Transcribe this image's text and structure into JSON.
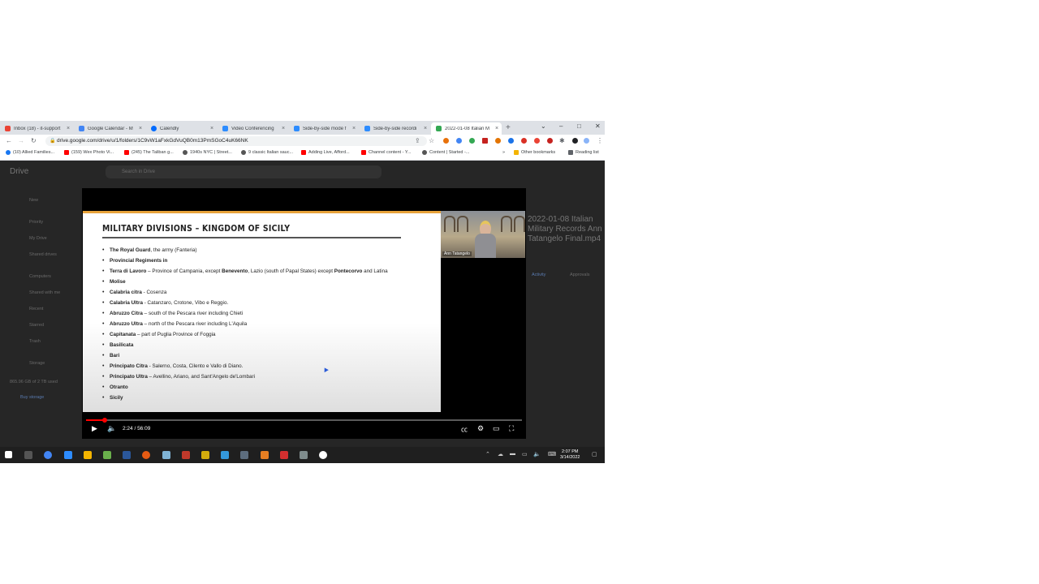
{
  "browser": {
    "tabs": [
      {
        "title": "Inbox (18) - it-support",
        "color": "#ea4335"
      },
      {
        "title": "Google Calendar - M",
        "color": "#4285f4"
      },
      {
        "title": "Calendly",
        "color": "#006bff"
      },
      {
        "title": "Video Conferencing",
        "color": "#2d8cff"
      },
      {
        "title": "Side-by-side mode f",
        "color": "#2d8cff"
      },
      {
        "title": "Side-by-side recordi",
        "color": "#2d8cff"
      },
      {
        "title": "2022-01-08 Italian M",
        "color": "#34a853"
      }
    ],
    "new_tab": "+",
    "url": "drive.google.com/drive/u/1/folders/1C9vW1aFxkGdVuQB0m13PmSGoC4uK66NK",
    "bookmarks": [
      {
        "label": "(10) Allied Families...",
        "color": "#1877f2"
      },
      {
        "label": "(159) Wex Photo Vi...",
        "color": "#ff0000"
      },
      {
        "label": "(245) The Taliban g...",
        "color": "#ff0000"
      },
      {
        "label": "1940s NYC | Street...",
        "color": "#555555"
      },
      {
        "label": "9 classic Italian sauc...",
        "color": "#555555"
      },
      {
        "label": "Adding Live, Afford...",
        "color": "#ff0000"
      },
      {
        "label": "Channel content - Y...",
        "color": "#ff0000"
      },
      {
        "label": "Content | Started -...",
        "color": "#555555"
      }
    ],
    "other_bookmarks": "Other bookmarks",
    "reading_list": "Reading list"
  },
  "drive": {
    "logo": "Drive",
    "search_placeholder": "Search in Drive",
    "nav": [
      "New",
      "Priority",
      "My Drive",
      "Shared drives",
      "Computers",
      "Shared with me",
      "Recent",
      "Starred",
      "Trash",
      "Storage"
    ],
    "storage_text": "865.96 GB of 2 TB used",
    "buy_storage": "Buy storage",
    "details_title": "2022-01-08 Italian Military Records Ann Tatangelo Final.mp4",
    "details_tab_activity": "Activity",
    "details_tab_approvals": "Approvals"
  },
  "video": {
    "slide_title": "MILITARY DIVISIONS – KINGDOM OF SICILY",
    "bullets": [
      {
        "b": "The Royal Guard",
        "t": ", the army (Fanteria)"
      },
      {
        "b": "Provincial Regiments in",
        "t": ""
      },
      {
        "b": "Terra di Lavoro",
        "t": " – Province of Campania, except ",
        "b2": "Benevento",
        "t2": ", Lazio (south of Papal States) except ",
        "b3": "Pontecorvo",
        "t3": " and Latina"
      },
      {
        "b": "Molise",
        "t": ""
      },
      {
        "b": "Calabria citra",
        "t": " - Cosenza"
      },
      {
        "b": "Calabria Ultra",
        "t": " - Catanzaro, Crotone, Vibo e Reggio."
      },
      {
        "b": "Abruzzo Citra",
        "t": " – south of the Pescara river including Chieti"
      },
      {
        "b": "Abruzzo Ultra",
        "t": " – north of the Pescara river including L'Aquila"
      },
      {
        "b": "Capitanata",
        "t": " – part of Puglia Province of Foggia"
      },
      {
        "b": "Basilicata",
        "t": ""
      },
      {
        "b": "Bari",
        "t": ""
      },
      {
        "b": "Principato Citra",
        "t": " - Salerno, Costa, Cilento e Vallo di Diano."
      },
      {
        "b": "Principato Ultra",
        "t": " – Avellino, Ariano, and Sant'Angelo de'Lombari"
      },
      {
        "b": "Otranto",
        "t": ""
      },
      {
        "b": "Sicily",
        "t": ""
      }
    ],
    "speaker_name": "Ann Tatangelo",
    "time_display": "2:24 / 56:09",
    "progress": 0.043
  },
  "taskbar": {
    "time": "2:07 PM",
    "date": "3/14/2022"
  }
}
